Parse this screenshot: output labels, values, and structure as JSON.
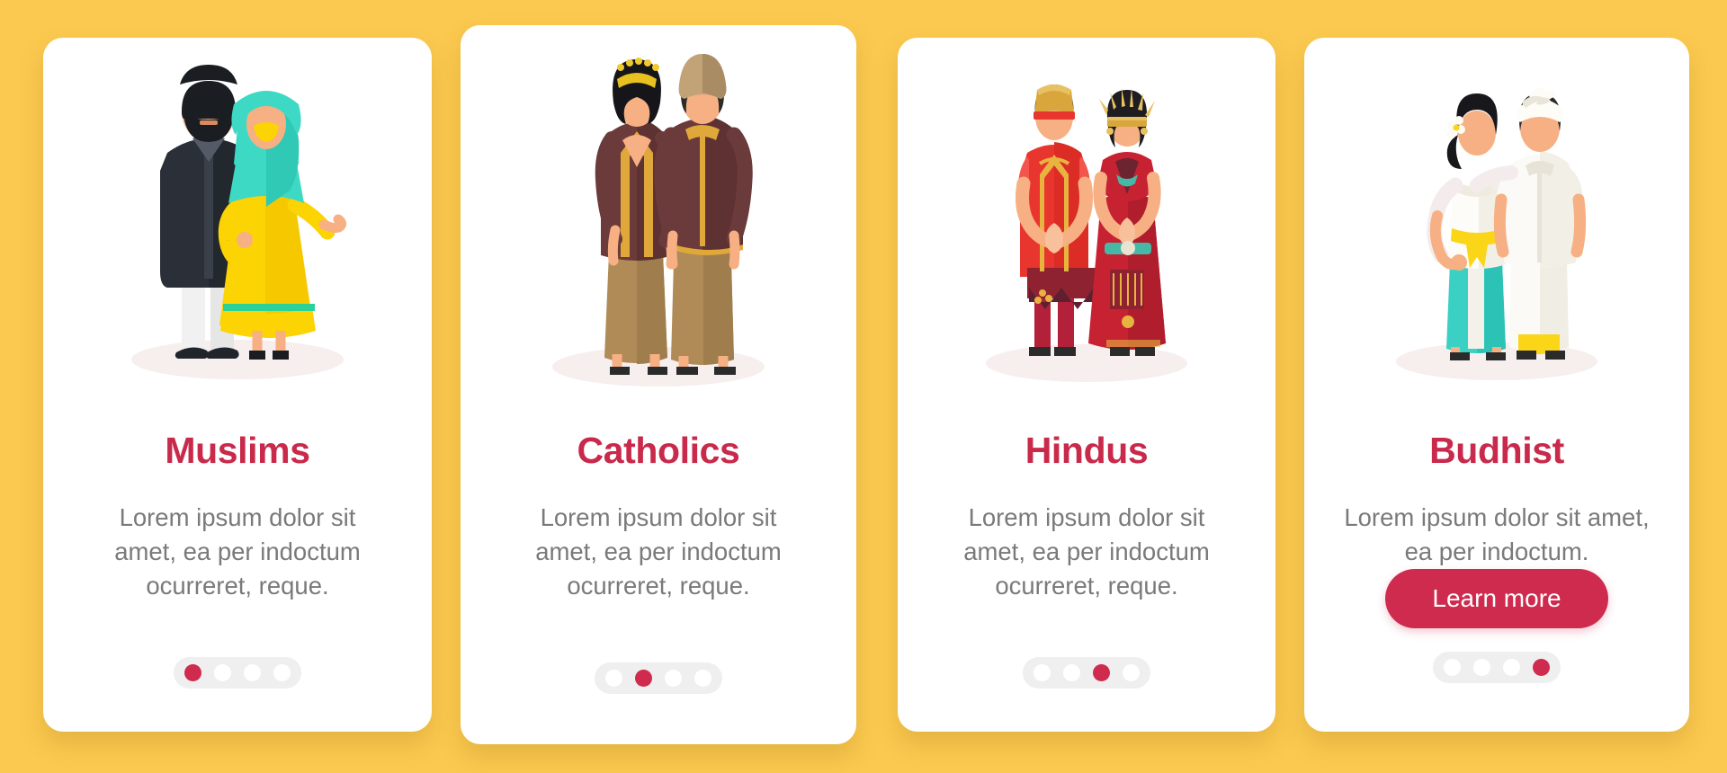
{
  "page": {
    "background_color": "#fbc94f",
    "accent_color": "#c9294a",
    "button_color": "#cf2b4e",
    "body_text_color": "#7a7a7a",
    "card_background": "#ffffff"
  },
  "cards": [
    {
      "title": "Muslims",
      "description": "Lorem ipsum dolor sit amet, ea per indoctum ocurreret, reque.",
      "illustration": "muslim-couple-illustration",
      "pagination": {
        "total": 4,
        "active_index": 0
      },
      "has_button": false
    },
    {
      "title": "Catholics",
      "description": "Lorem ipsum dolor sit amet, ea per indoctum ocurreret, reque.",
      "illustration": "catholic-couple-illustration",
      "pagination": {
        "total": 4,
        "active_index": 1
      },
      "has_button": false
    },
    {
      "title": "Hindus",
      "description": "Lorem ipsum dolor sit amet, ea per indoctum ocurreret, reque.",
      "illustration": "hindu-couple-illustration",
      "pagination": {
        "total": 4,
        "active_index": 2
      },
      "has_button": false
    },
    {
      "title": "Budhist",
      "description": "Lorem ipsum dolor sit amet, ea per indoctum.",
      "illustration": "buddhist-couple-illustration",
      "pagination": {
        "total": 4,
        "active_index": 3
      },
      "has_button": true,
      "button_label": "Learn more"
    }
  ]
}
